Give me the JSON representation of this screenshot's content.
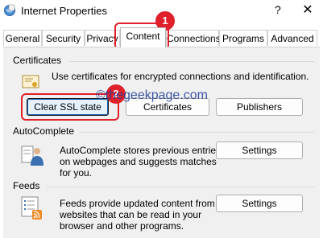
{
  "window": {
    "title": "Internet Properties",
    "help_glyph": "?",
    "close_glyph": "✕"
  },
  "tabs": [
    {
      "label": "General"
    },
    {
      "label": "Security"
    },
    {
      "label": "Privacy"
    },
    {
      "label": "Content",
      "active": true
    },
    {
      "label": "Connections"
    },
    {
      "label": "Programs"
    },
    {
      "label": "Advanced"
    }
  ],
  "certificates": {
    "section_label": "Certificates",
    "description": "Use certificates for encrypted connections and identification.",
    "clear_ssl_label": "Clear SSL state",
    "certificates_label": "Certificates",
    "publishers_label": "Publishers"
  },
  "autocomplete": {
    "section_label": "AutoComplete",
    "description_lines": [
      "AutoComplete stores previous entries",
      "on webpages and suggests matches",
      "for you."
    ],
    "settings_label": "Settings"
  },
  "feeds": {
    "section_label": "Feeds",
    "description_lines": [
      "Feeds provide updated content from",
      "websites that can be read in your",
      "browser and other programs."
    ],
    "settings_label": "Settings"
  },
  "annotations": {
    "badge1": "1",
    "badge2": "2",
    "watermark": "©thegeekpage.com",
    "highlight_color": "#e0202a"
  }
}
